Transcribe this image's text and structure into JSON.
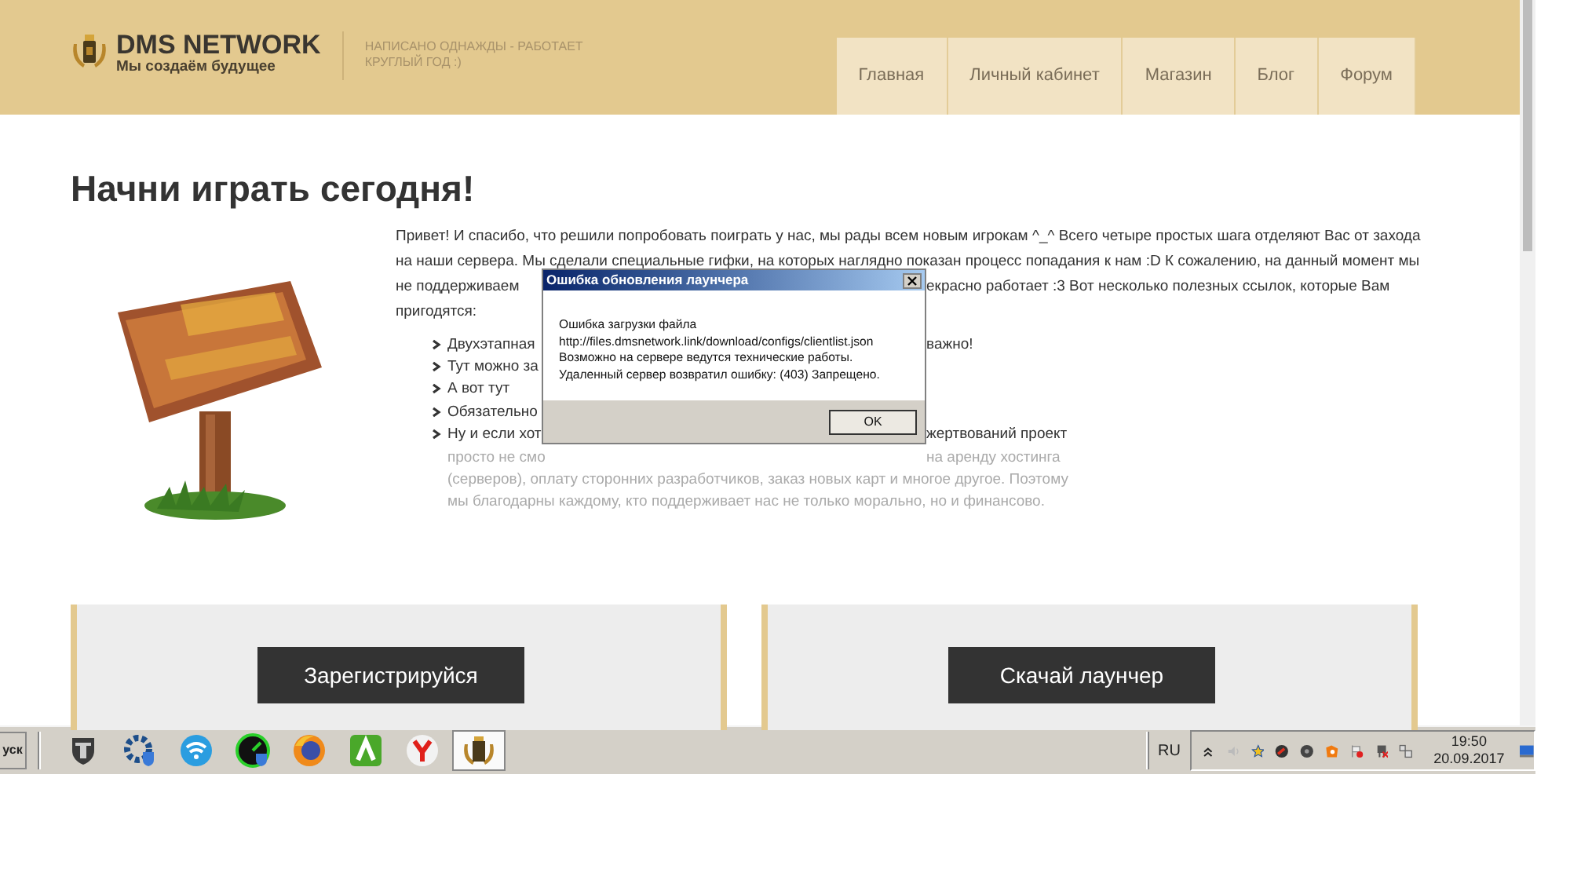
{
  "header": {
    "logo_title": "DMS NETWORK",
    "logo_subtitle": "Мы создаём будущее",
    "tagline_lines": [
      "НАПИСАНО ОДНАЖДЫ - РАБОТАЕТ",
      "КРУГЛЫЙ ГОД :)"
    ]
  },
  "nav": [
    {
      "label": "Главная"
    },
    {
      "label": "Личный кабинет"
    },
    {
      "label": "Магазин"
    },
    {
      "label": "Блог"
    },
    {
      "label": "Форум"
    }
  ],
  "heading": "Начни играть сегодня!",
  "intro_lines": [
    {
      "fragments": [
        "Привет! И спасибо, что решили попробовать поиграть у нас, мы рады всем новым игрокам ^_^ Всего четыре простых шага отделяют Вас от захода"
      ]
    },
    {
      "fragments": [
        "на наши сервера. Мы сделали специальные гифки, на которых наглядно показан процесс попадания к нам :D К сожалению, на данный момент мы"
      ]
    },
    {
      "fragments": [
        "не поддерживаем",
        "екрасно работает :3 Вот несколько полезных ссылок, которые Вам"
      ]
    },
    {
      "fragments": [
        "пригодятся:"
      ]
    }
  ],
  "bullet_lines": [
    {
      "kind": "bullet",
      "faded": false,
      "fragments": [
        "Двухэтапная",
        "важно!"
      ]
    },
    {
      "kind": "bullet",
      "faded": false,
      "fragments": [
        "Тут можно за"
      ]
    },
    {
      "kind": "bullet",
      "faded": false,
      "fragments": [
        "А вот тут"
      ]
    },
    {
      "kind": "bullet",
      "faded": false,
      "fragments": [
        "Обязательно"
      ]
    },
    {
      "kind": "bullet",
      "faded": false,
      "fragments": [
        "Ну и если хот",
        "жертвований проект"
      ]
    },
    {
      "kind": "continuation",
      "faded": true,
      "fragments": [
        "просто не смо",
        "на аренду хостинга"
      ]
    },
    {
      "kind": "continuation",
      "faded": true,
      "fragments": [
        "(серверов), оплату сторонних разработчиков, заказ новых карт и многое другое. Поэтому"
      ]
    },
    {
      "kind": "continuation",
      "faded": true,
      "fragments": [
        "мы благодарны каждому, кто поддерживает нас не только морально, но и финансово."
      ]
    }
  ],
  "cards": [
    {
      "button": "Зарегистрируйся"
    },
    {
      "button": "Скачай лаунчер"
    }
  ],
  "dialog": {
    "title": "Ошибка обновления лаунчера",
    "lines": [
      "Ошибка загрузки файла",
      "http://files.dmsnetwork.link/download/configs/clientlist.json",
      "Возможно на сервере ведутся технические работы.",
      "Удаленный сервер возвратил ошибку: (403) Запрещено."
    ],
    "ok": "OK"
  },
  "taskbar": {
    "start": "уск",
    "apps": [
      {
        "kind": "tank",
        "active": false
      },
      {
        "kind": "gear",
        "active": false
      },
      {
        "kind": "wifi",
        "active": false
      },
      {
        "kind": "gauge",
        "active": false
      },
      {
        "kind": "browser",
        "active": false
      },
      {
        "kind": "green-app",
        "active": false
      },
      {
        "kind": "red-app",
        "active": false
      },
      {
        "kind": "crest",
        "active": true
      }
    ],
    "language": "RU",
    "tray": [
      {
        "kind": "chevron"
      },
      {
        "kind": "speaker"
      },
      {
        "kind": "star"
      },
      {
        "kind": "red-disc"
      },
      {
        "kind": "dark-disc"
      },
      {
        "kind": "orange-app"
      },
      {
        "kind": "flag"
      },
      {
        "kind": "power"
      },
      {
        "kind": "network"
      }
    ],
    "clock_time": "19:50",
    "clock_date": "20.09.2017"
  }
}
